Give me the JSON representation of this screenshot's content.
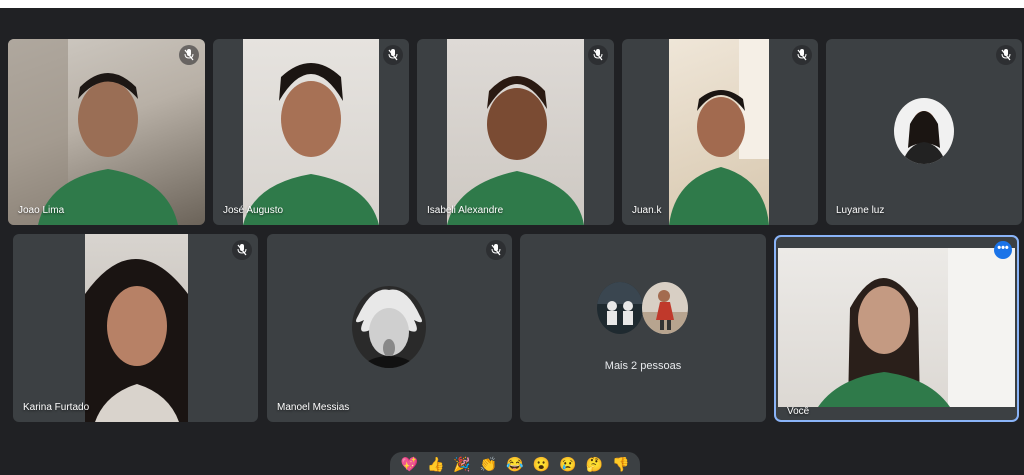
{
  "participants": [
    {
      "name": "Joao Lima"
    },
    {
      "name": "José Augusto"
    },
    {
      "name": "Isabeli Alexandre"
    },
    {
      "name": "Juan.k"
    },
    {
      "name": "Luyane luz"
    },
    {
      "name": "Karina Furtado"
    },
    {
      "name": "Manoel Messias"
    },
    {
      "name": "Você"
    }
  ],
  "more_people": {
    "label": "Mais 2 pessoas"
  },
  "reactions": [
    "💖",
    "👍",
    "🎉",
    "👏",
    "😂",
    "😮",
    "😢",
    "🤔",
    "👎"
  ],
  "colors": {
    "background": "#202124",
    "tile": "#3c4043",
    "self_outline": "#8ab4f8",
    "accent": "#1a73e8"
  }
}
